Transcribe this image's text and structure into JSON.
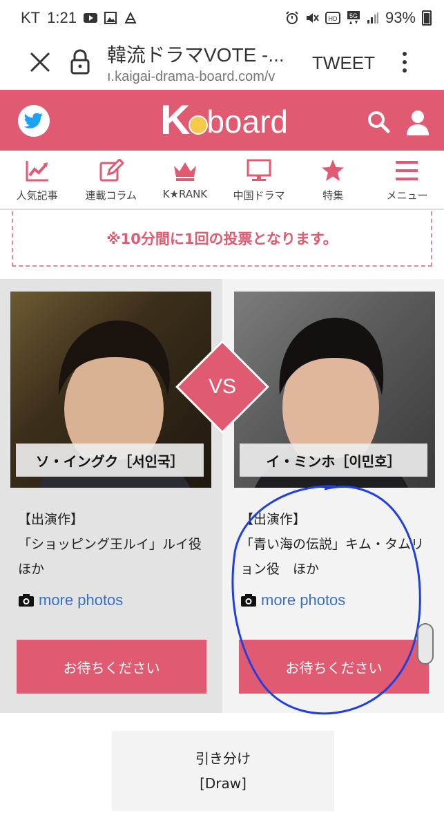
{
  "status_bar": {
    "carrier": "KT",
    "time": "1:21",
    "battery": "93%"
  },
  "browser": {
    "title": "韓流ドラマVOTE -...",
    "url": "ı.kaigai-drama-board.com/v",
    "tweet_label": "TWEET",
    "icons": [
      "close-icon",
      "lock-icon",
      "more-vert-icon"
    ]
  },
  "header": {
    "logo_k": "K",
    "logo_rest": "board",
    "accent_color": "#e05a72",
    "icons": [
      "twitter-icon",
      "search-icon",
      "user-icon"
    ]
  },
  "nav": {
    "items": [
      {
        "label": "人気記事",
        "icon": "chart-icon"
      },
      {
        "label": "連載コラム",
        "icon": "edit-icon"
      },
      {
        "label": "K★RANK",
        "icon": "crown-icon"
      },
      {
        "label": "中国ドラマ",
        "icon": "monitor-icon"
      },
      {
        "label": "特集",
        "icon": "star-icon"
      },
      {
        "label": "メニュー",
        "icon": "menu-icon"
      }
    ]
  },
  "notice": {
    "text": "※10分間に1回の投票となります。"
  },
  "vote": {
    "vs_label": "VS",
    "candidates": [
      {
        "name": "ソ・イングク［서인국］",
        "works_heading": "【出演作】",
        "works_text": "「ショッピング王ルイ」ルイ役　ほか",
        "more_photos": "more photos",
        "button_label": "お待ちください"
      },
      {
        "name": "イ・ミンホ［이민호］",
        "works_heading": "【出演作】",
        "works_text": "「青い海の伝説」キム・タムリョン役　ほか",
        "more_photos": "more photos",
        "button_label": "お待ちください"
      }
    ]
  },
  "draw": {
    "line1": "引き分け",
    "line2": "[Draw]"
  }
}
